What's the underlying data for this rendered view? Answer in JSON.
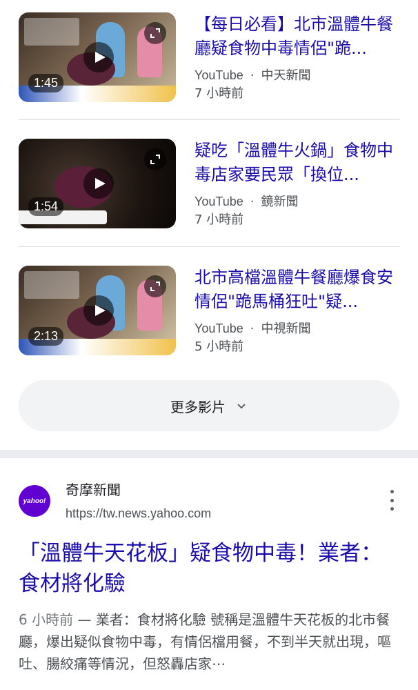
{
  "videos": [
    {
      "title": "【每日必看】北市溫體牛餐廳疑食物中毒情侶\"跪...",
      "duration": "1:45",
      "platform": "YouTube",
      "channel": "中天新聞",
      "time": "7 小時前",
      "thumb_colors": [
        "#3a2d24",
        "#c9b99c"
      ]
    },
    {
      "title": "疑吃「溫體牛火鍋」食物中毒店家要民眾「換位...",
      "duration": "1:54",
      "platform": "YouTube",
      "channel": "鏡新聞",
      "time": "7 小時前",
      "thumb_colors": [
        "#1c1410",
        "#4a3a30"
      ]
    },
    {
      "title": "北市高檔溫體牛餐廳爆食安情侶\"跪馬桶狂吐\"疑...",
      "duration": "2:13",
      "platform": "YouTube",
      "channel": "中視新聞",
      "time": "5 小時前",
      "thumb_colors": [
        "#3a2d24",
        "#d6c8aa"
      ]
    }
  ],
  "more_videos_label": "更多影片",
  "result": {
    "site_name": "奇摩新聞",
    "url": "https://tw.news.yahoo.com",
    "favicon_text": "yahoo!",
    "title": "「溫體牛天花板」疑食物中毒！業者：食材將化驗",
    "snippet_date": "6 小時前",
    "snippet_sep": " — ",
    "snippet_text": "業者：食材將化驗 號稱是溫體牛天花板的北市餐廳，爆出疑似食物中毒，有情侶檔用餐，不到半天就出現，嘔吐、腸絞痛等情況，但怒轟店家⋯"
  },
  "colors": {
    "link": "#1a0dab",
    "yahoo": "#6001d2",
    "pill_bg": "#f1f3f4",
    "separator": "#ebecf0"
  },
  "icons": [
    "play-icon",
    "expand-icon",
    "chevron-down-icon",
    "more-vert-icon"
  ]
}
